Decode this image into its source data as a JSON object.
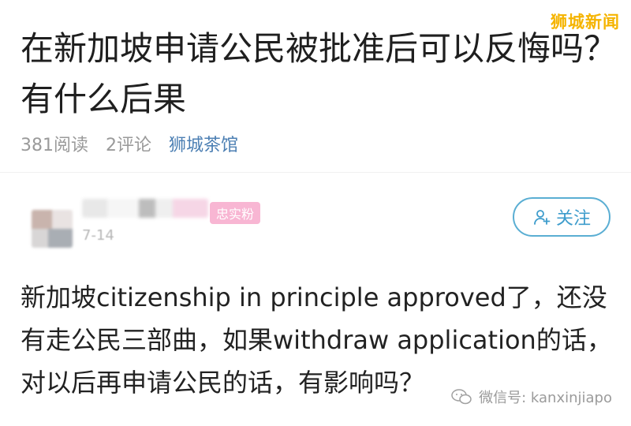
{
  "brand": {
    "name": "狮城新闻"
  },
  "post": {
    "title": "在新加坡申请公民被批准后可以反悔吗？有什么后果",
    "reads": "381阅读",
    "comments": "2评论",
    "channel": "狮城茶馆"
  },
  "author": {
    "badge": "忠实粉",
    "date": "7-14",
    "follow_label": "关注",
    "icon": "add-user-icon"
  },
  "content": {
    "text": "新加坡citizenship in principle approved了，还没有走公民三部曲，如果withdraw application的话，对以后再申请公民的话，有影响吗？"
  },
  "watermark": {
    "icon": "wechat-icon",
    "text": "微信号: kanxinjiapo"
  },
  "colors": {
    "brand": "#f5b400",
    "accent": "#3d9ccc",
    "channel": "#4c7fb3",
    "badge": "#f8b6d3"
  }
}
